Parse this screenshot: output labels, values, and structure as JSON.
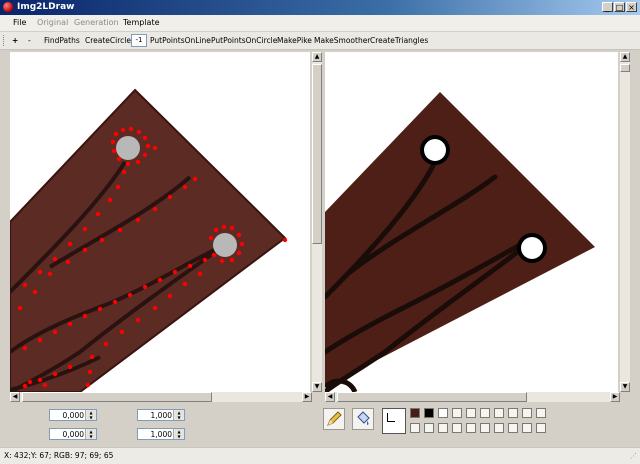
{
  "window": {
    "title": "Img2LDraw"
  },
  "menu": [
    {
      "label": "File",
      "enabled": true
    },
    {
      "label": "Original",
      "enabled": false
    },
    {
      "label": "Generation",
      "enabled": false
    },
    {
      "label": "Template",
      "enabled": true
    }
  ],
  "toolbar": {
    "plus": "+",
    "minus": "-",
    "find_paths": "FindPaths",
    "create_circle": "CreateCircle",
    "circle_value": "-1",
    "put_points_on_line": "PutPointsOnLine",
    "put_points_on_circle": "PutPointsOnCircle",
    "make_pike": "MakePike",
    "make_smoother": "MakeSmoother",
    "create_triangles": "CreateTriangles"
  },
  "controls": {
    "offset_x": "0,000",
    "offset_y": "0,000",
    "scale_x": "1,000",
    "scale_y": "1,000"
  },
  "palette": {
    "selected_color": "#3b1a14",
    "colors": [
      "#4a1e18",
      "#000000",
      "#ffffff"
    ],
    "empty_slots": 17
  },
  "icons": {
    "pencil": "pencil-icon",
    "fill": "paint-bucket-icon"
  },
  "status": {
    "text": "X: 432;Y: 67; RGB: 97; 69; 65"
  }
}
